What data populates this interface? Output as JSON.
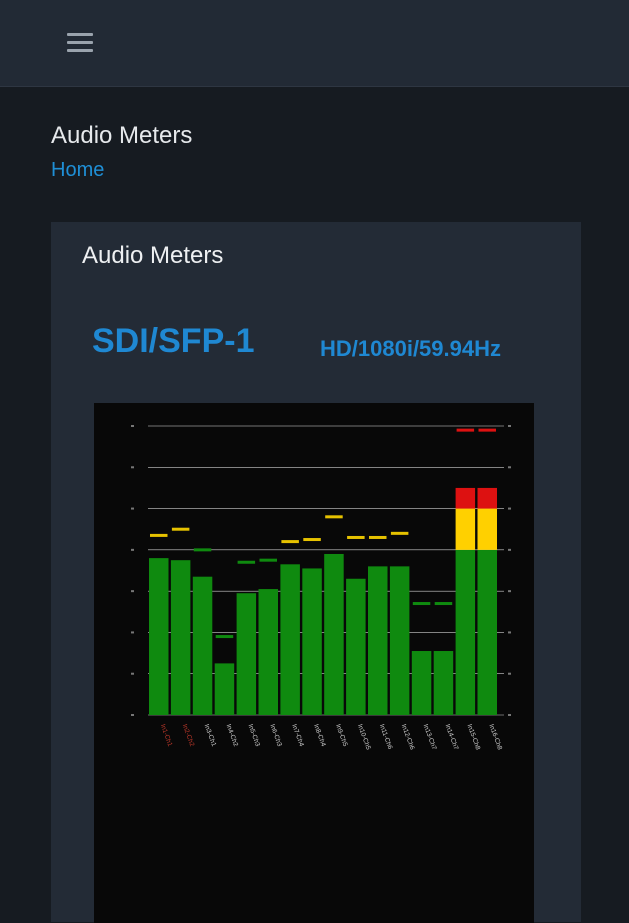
{
  "topbar": {
    "menu_icon": "hamburger-menu-icon"
  },
  "page": {
    "title": "Audio Meters",
    "breadcrumb": "Home"
  },
  "card": {
    "title": "Audio Meters",
    "source": "SDI/SFP-1",
    "format": "HD/1080i/59.94Hz"
  },
  "colors": {
    "green": "#0f8a0f",
    "yellow": "#ffd000",
    "red": "#dd1111",
    "peak": "#e6c200",
    "accent": "#1f88d2"
  },
  "chart_data": {
    "type": "bar",
    "categories": [
      "In1-Ch1",
      "In2-Ch2",
      "In3-Ch1",
      "In4-Ch2",
      "In5-Ch3",
      "In6-Ch3",
      "In7-Ch4",
      "In8-Ch4",
      "In9-Ch5",
      "In10-Ch5",
      "In11-Ch6",
      "In12-Ch6",
      "In13-Ch7",
      "In14-Ch7",
      "In15-Ch8",
      "In16-Ch8"
    ],
    "highlighted_categories": [
      "In1-Ch1",
      "In2-Ch2"
    ],
    "ylim": [
      0,
      7
    ],
    "values": [
      3.8,
      3.75,
      3.35,
      1.25,
      2.95,
      3.05,
      3.65,
      3.55,
      3.9,
      3.3,
      3.6,
      3.6,
      1.55,
      1.55,
      5.5,
      5.5
    ],
    "peaks": [
      4.35,
      4.5,
      4.0,
      1.9,
      3.7,
      3.75,
      4.2,
      4.25,
      4.8,
      4.3,
      4.3,
      4.4,
      2.7,
      2.7,
      6.9,
      6.9
    ],
    "peak_colors": [
      "yellow",
      "yellow",
      "green",
      "green",
      "green",
      "green",
      "yellow",
      "yellow",
      "yellow",
      "yellow",
      "yellow",
      "yellow",
      "green",
      "green",
      "red",
      "red"
    ],
    "zones": [
      {
        "from": 0,
        "to": 4,
        "color": "green"
      },
      {
        "from": 4,
        "to": 5,
        "color": "yellow"
      },
      {
        "from": 5,
        "to": 7,
        "color": "red"
      }
    ],
    "grid": true
  }
}
